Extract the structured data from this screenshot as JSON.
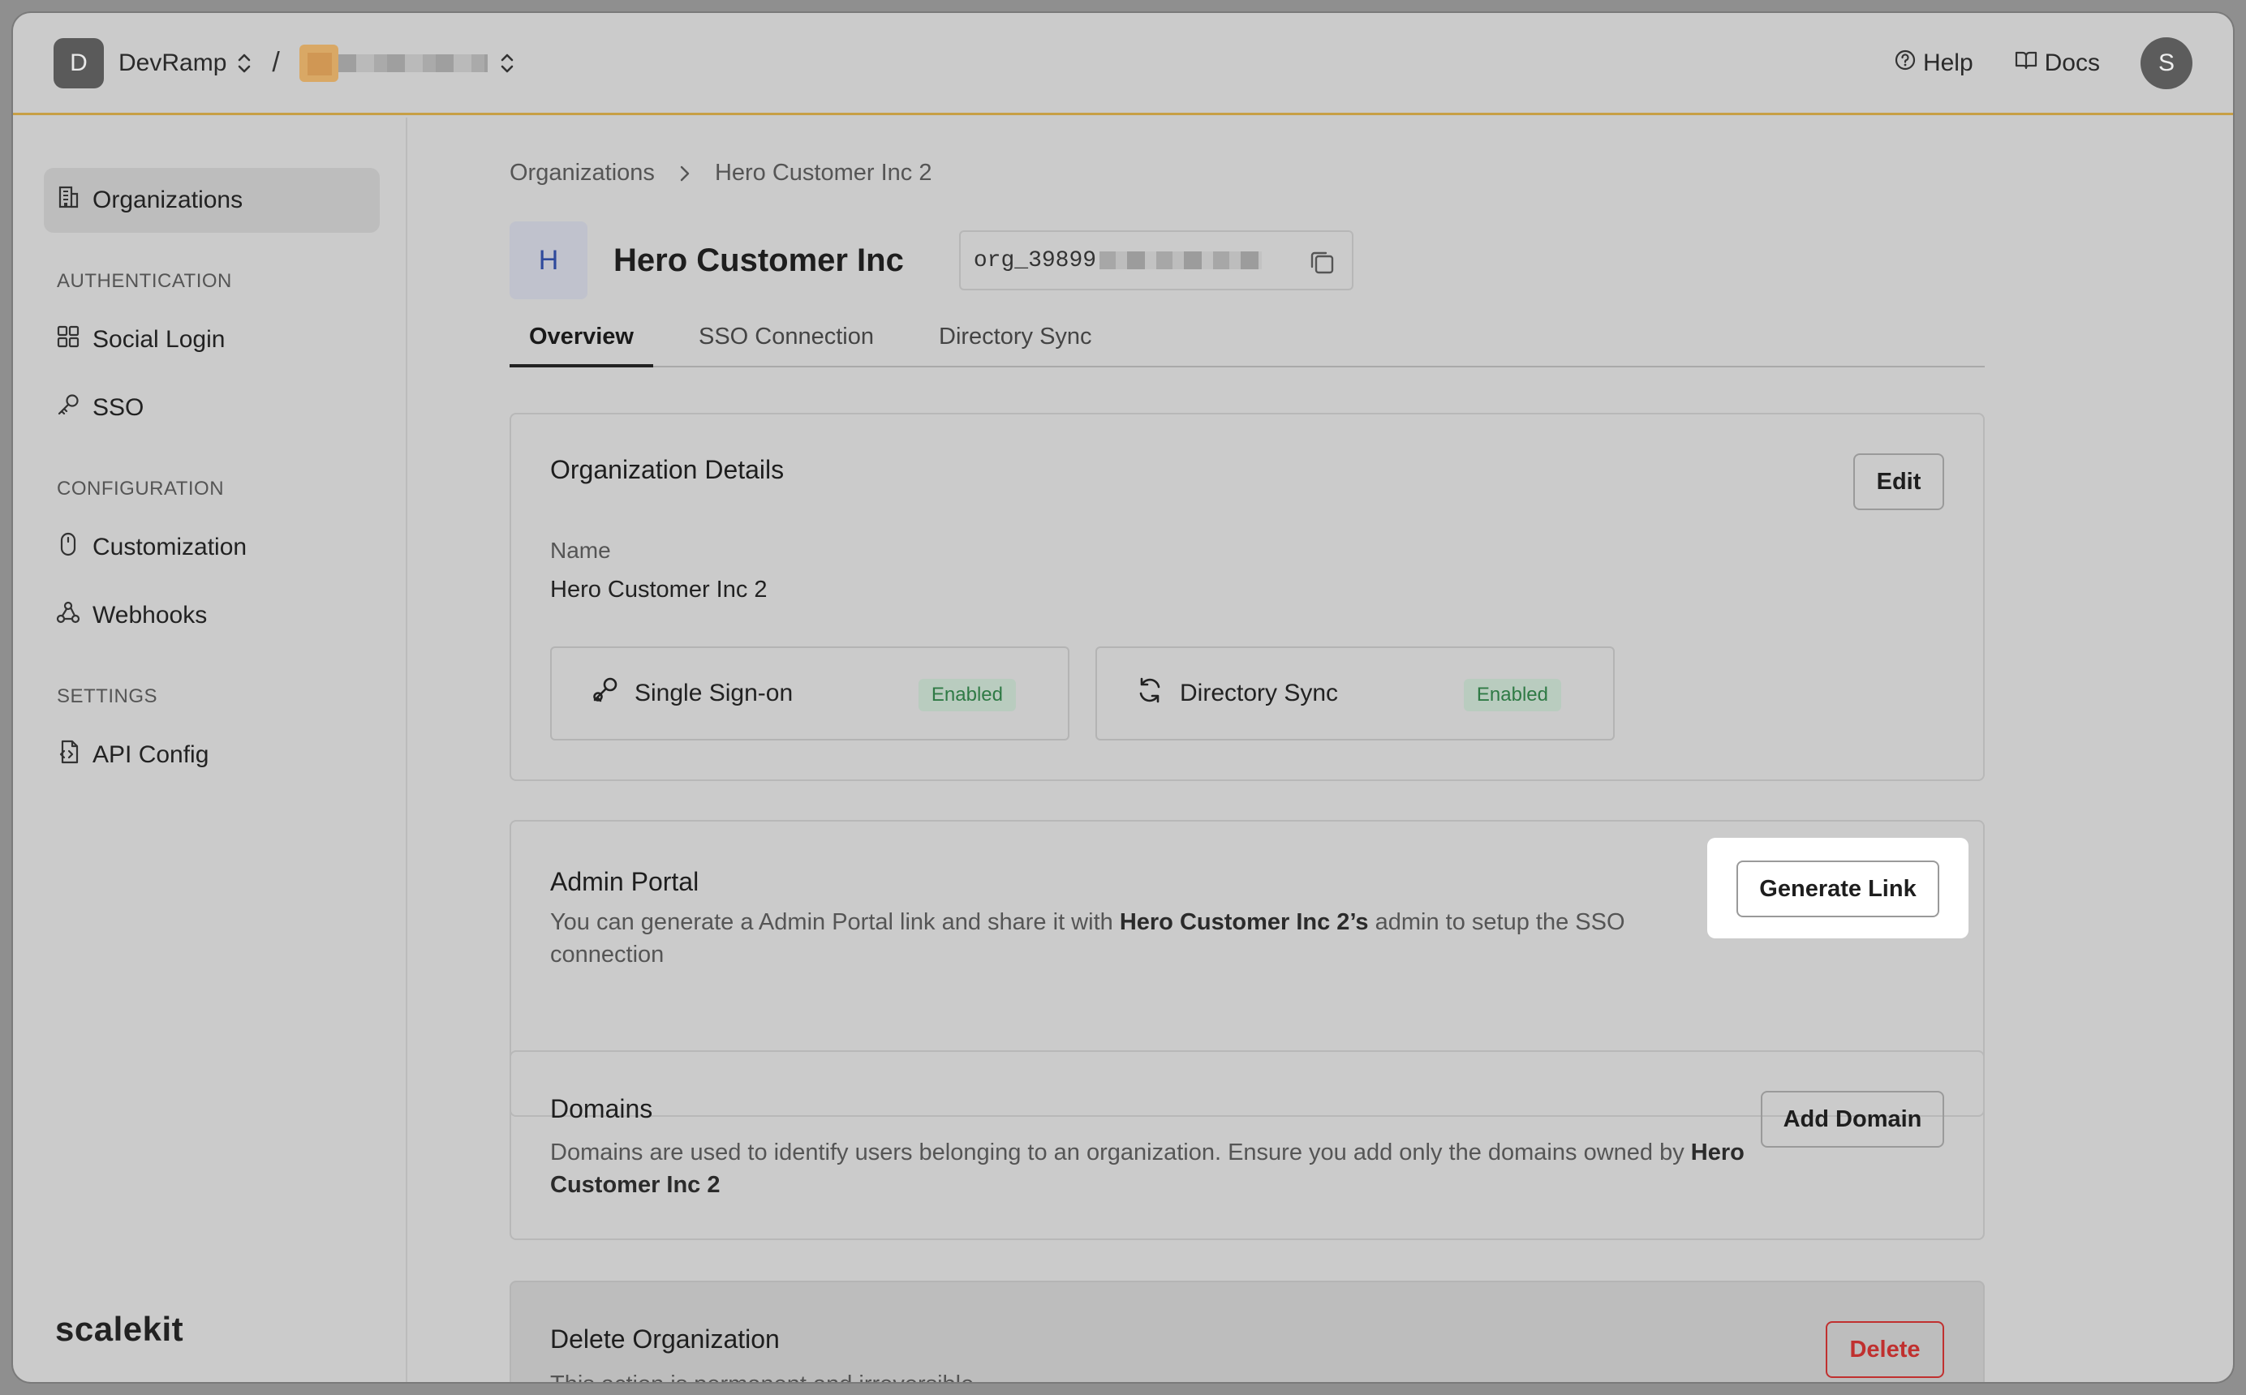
{
  "header": {
    "org_initial": "D",
    "org_name": "DevRamp",
    "separator": "/",
    "help_label": "Help",
    "docs_label": "Docs",
    "user_initial": "S"
  },
  "sidebar": {
    "items": [
      {
        "label": "Organizations"
      },
      {
        "label": "Social Login"
      },
      {
        "label": "SSO"
      },
      {
        "label": "Customization"
      },
      {
        "label": "Webhooks"
      },
      {
        "label": "API Config"
      }
    ],
    "sections": [
      "AUTHENTICATION",
      "CONFIGURATION",
      "SETTINGS"
    ],
    "brand": "scalekit"
  },
  "main": {
    "breadcrumb": [
      "Organizations",
      "Hero Customer Inc 2"
    ],
    "avatar_initial": "H",
    "title": "Hero Customer Inc",
    "org_id_prefix": "org_39899",
    "tabs": [
      "Overview",
      "SSO Connection",
      "Directory Sync"
    ],
    "details": {
      "title": "Organization Details",
      "edit_label": "Edit",
      "name_label": "Name",
      "name_value": "Hero Customer Inc 2",
      "features": [
        {
          "label": "Single Sign-on",
          "status": "Enabled"
        },
        {
          "label": "Directory Sync",
          "status": "Enabled"
        }
      ]
    },
    "admin_portal": {
      "title": "Admin Portal",
      "desc_pre": "You can generate a Admin Portal link and share it with",
      "desc_bold": "Hero Customer Inc 2’s",
      "desc_post": "admin to setup the SSO connection",
      "button_label": "Generate Link"
    },
    "domains": {
      "title": "Domains",
      "desc": "Domains are used to identify users belonging to an organization. Ensure you add only the domains owned by",
      "desc_bold": "Hero Customer Inc 2",
      "button_label": "Add Domain"
    },
    "delete": {
      "title": "Delete Organization",
      "desc": "This action is permanent and irreversible",
      "button_label": "Delete"
    }
  },
  "colors": {
    "accent_border": "#c79f45",
    "enabled_badge": "#2f7a45",
    "danger": "#c0302f"
  }
}
